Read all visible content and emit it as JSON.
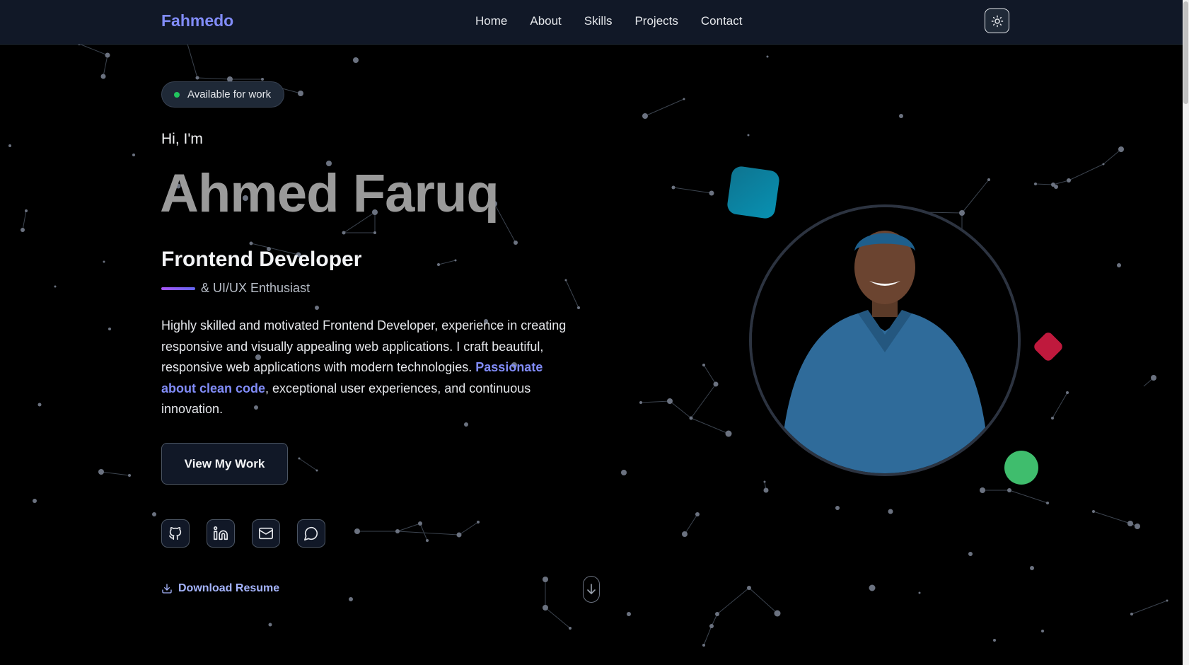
{
  "nav": {
    "logo": "Fahmedo",
    "links": [
      "Home",
      "About",
      "Skills",
      "Projects",
      "Contact"
    ],
    "theme_toggle_icon": "sun-icon"
  },
  "hero": {
    "badge": "Available for work",
    "greeting": "Hi, I'm",
    "name": "Ahmed Faruq",
    "role": "Frontend Developer",
    "subrole": "& UI/UX Enthusiast",
    "bio_intro": "Highly skilled and motivated Frontend Developer, experience in creating responsive and visually appealing web applications. I craft beautiful, responsive web applications with modern technologies.",
    "bio_highlight": "Passionate about clean code",
    "bio_outro": ", exceptional user experiences, and continuous innovation.",
    "cta_label": "View My Work",
    "socials": [
      "github-icon",
      "linkedin-icon",
      "mail-icon",
      "message-icon"
    ],
    "resume_label": "Download Resume"
  },
  "colors": {
    "background": "#000000",
    "navbar": "#111827",
    "accent": "#818cf8",
    "available_dot": "#22c55e",
    "shape_teal": "#0891b2",
    "shape_pink": "#e11d48",
    "shape_green": "#4ade80"
  }
}
